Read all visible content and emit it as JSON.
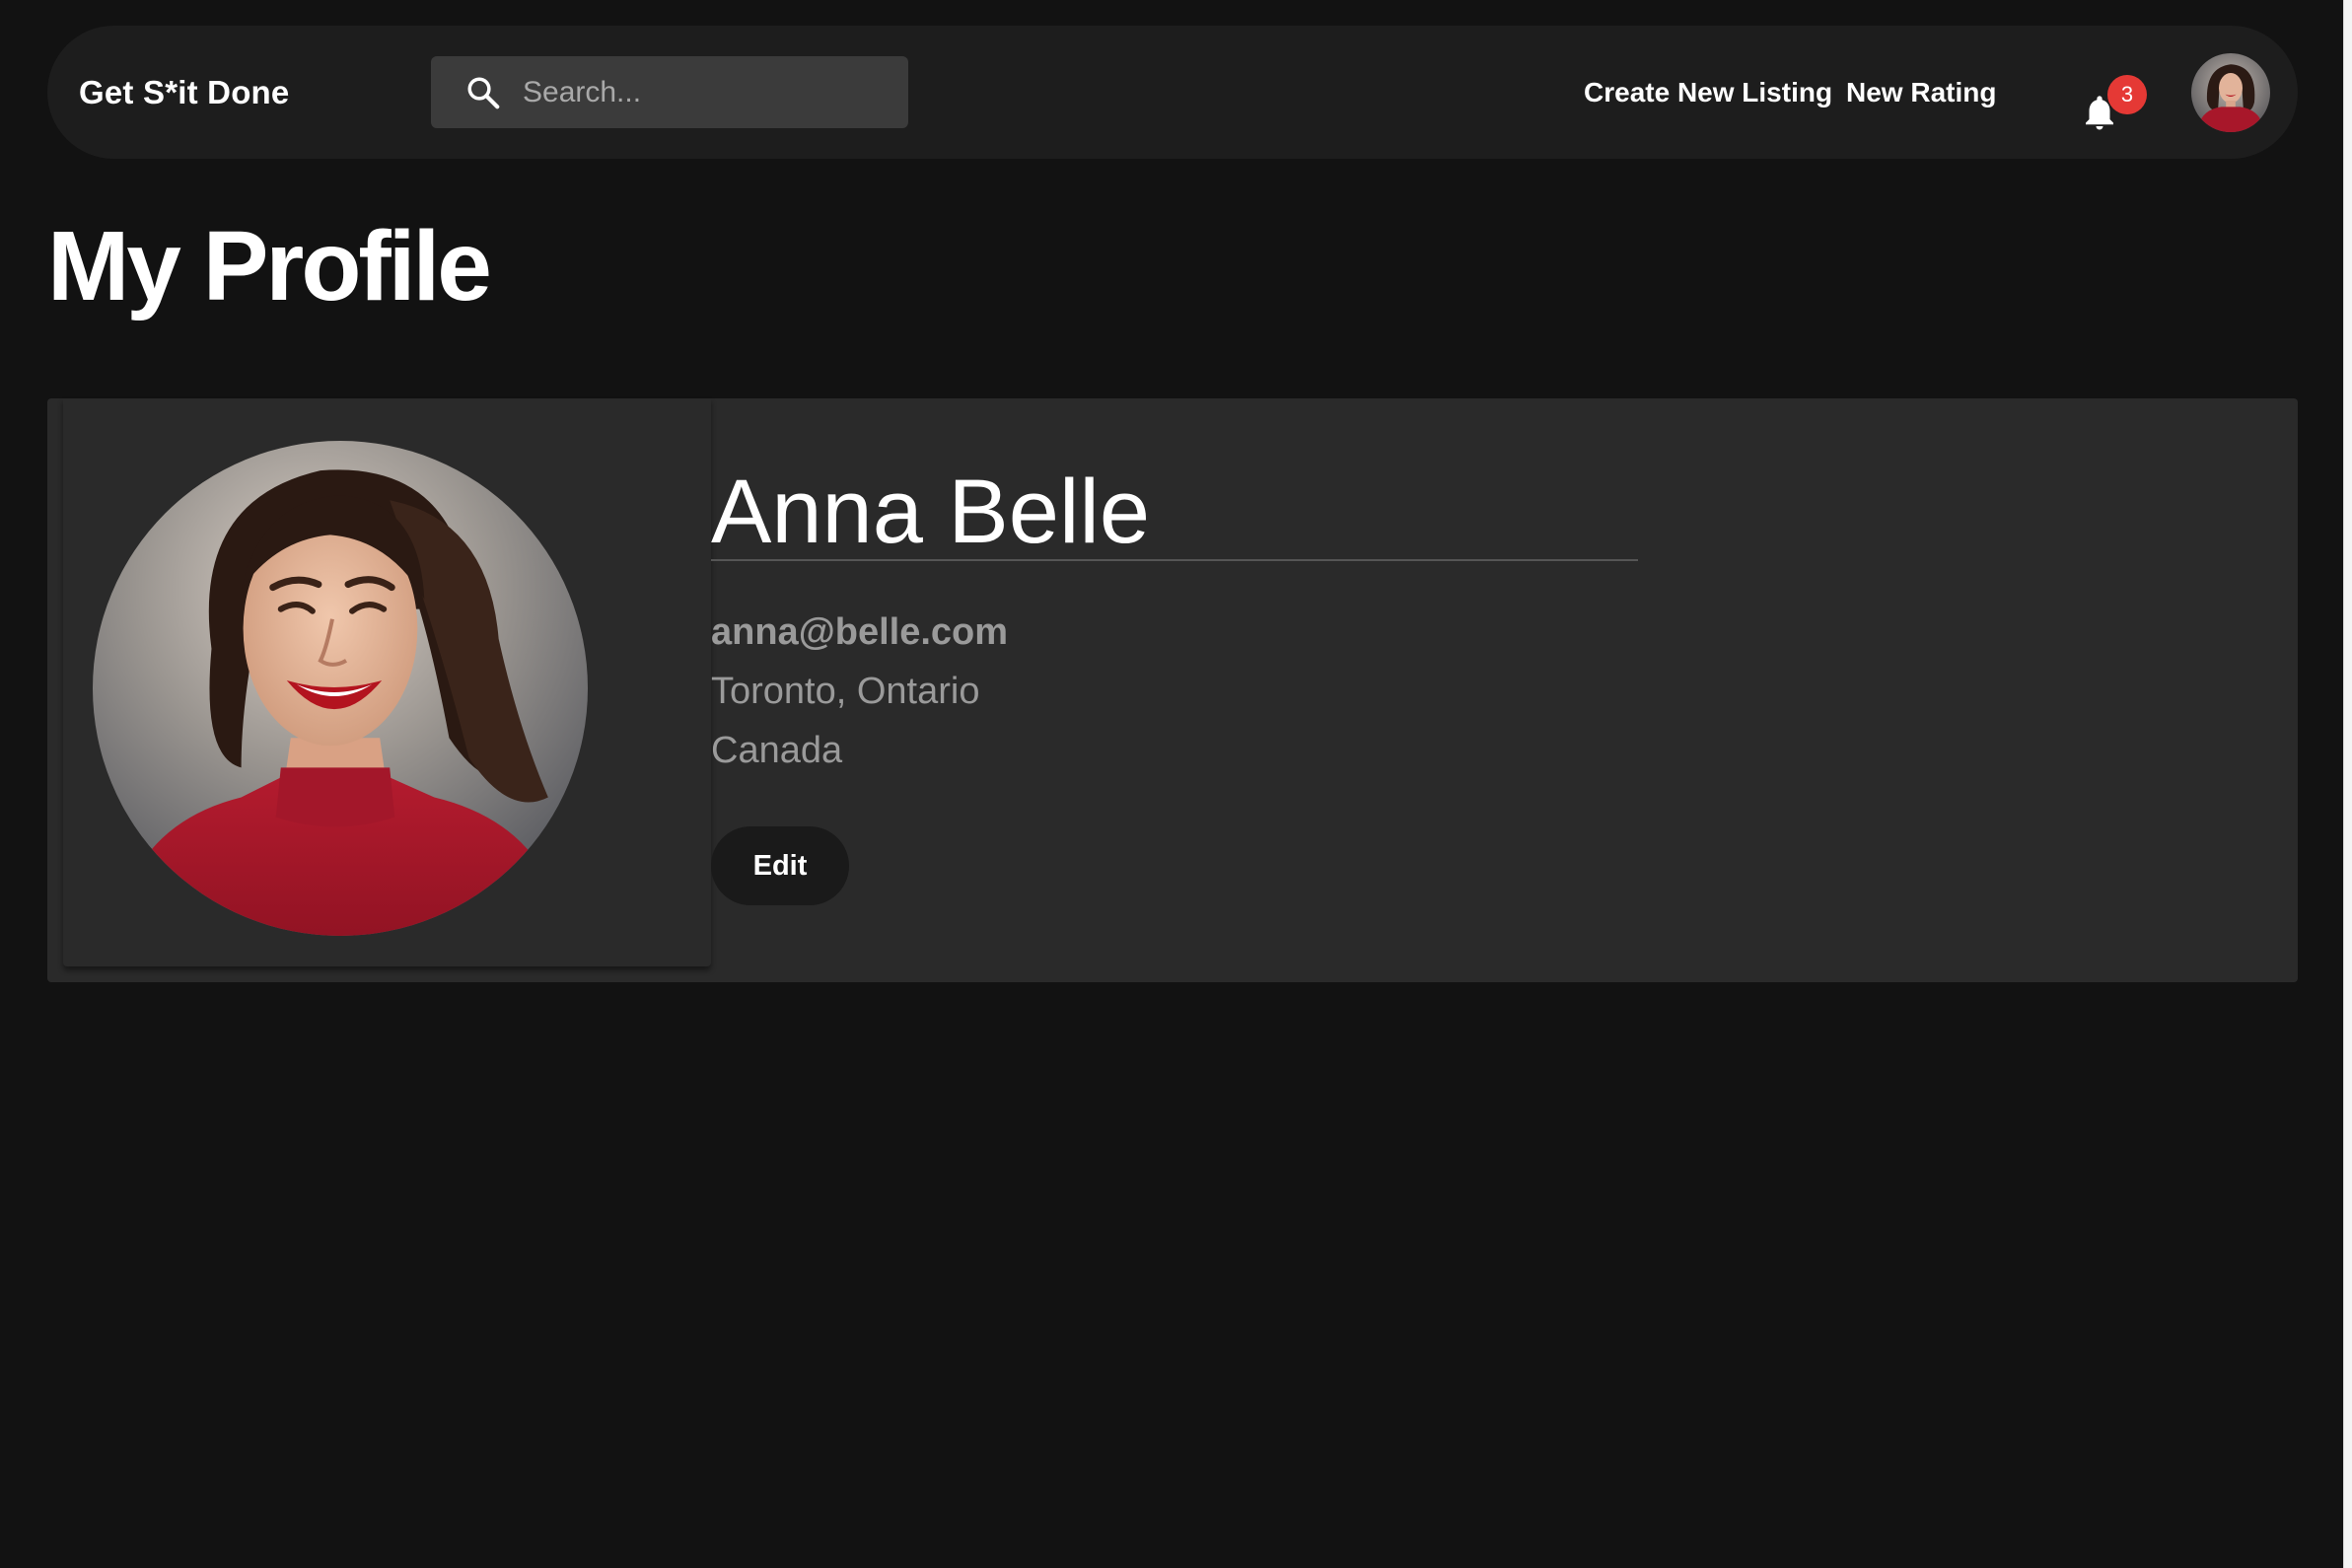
{
  "navbar": {
    "brand": "Get S*it Done",
    "search": {
      "placeholder": "Search...",
      "value": ""
    },
    "links": {
      "create_listing": "Create New Listing",
      "new_rating": "New Rating"
    },
    "notifications": {
      "count": "3",
      "icon": "bell-icon"
    },
    "avatar_icon": "user-avatar"
  },
  "page": {
    "title": "My Profile"
  },
  "profile": {
    "name": "Anna Belle",
    "email": "anna@belle.com",
    "city_region": "Toronto, Ontario",
    "country": "Canada",
    "edit_label": "Edit"
  },
  "colors": {
    "background": "#121212",
    "navbar": "#1d1d1d",
    "card": "#2a2a2a",
    "badge": "#e53935",
    "muted_text": "#9a9a9a",
    "sweater": "#a8172a"
  }
}
